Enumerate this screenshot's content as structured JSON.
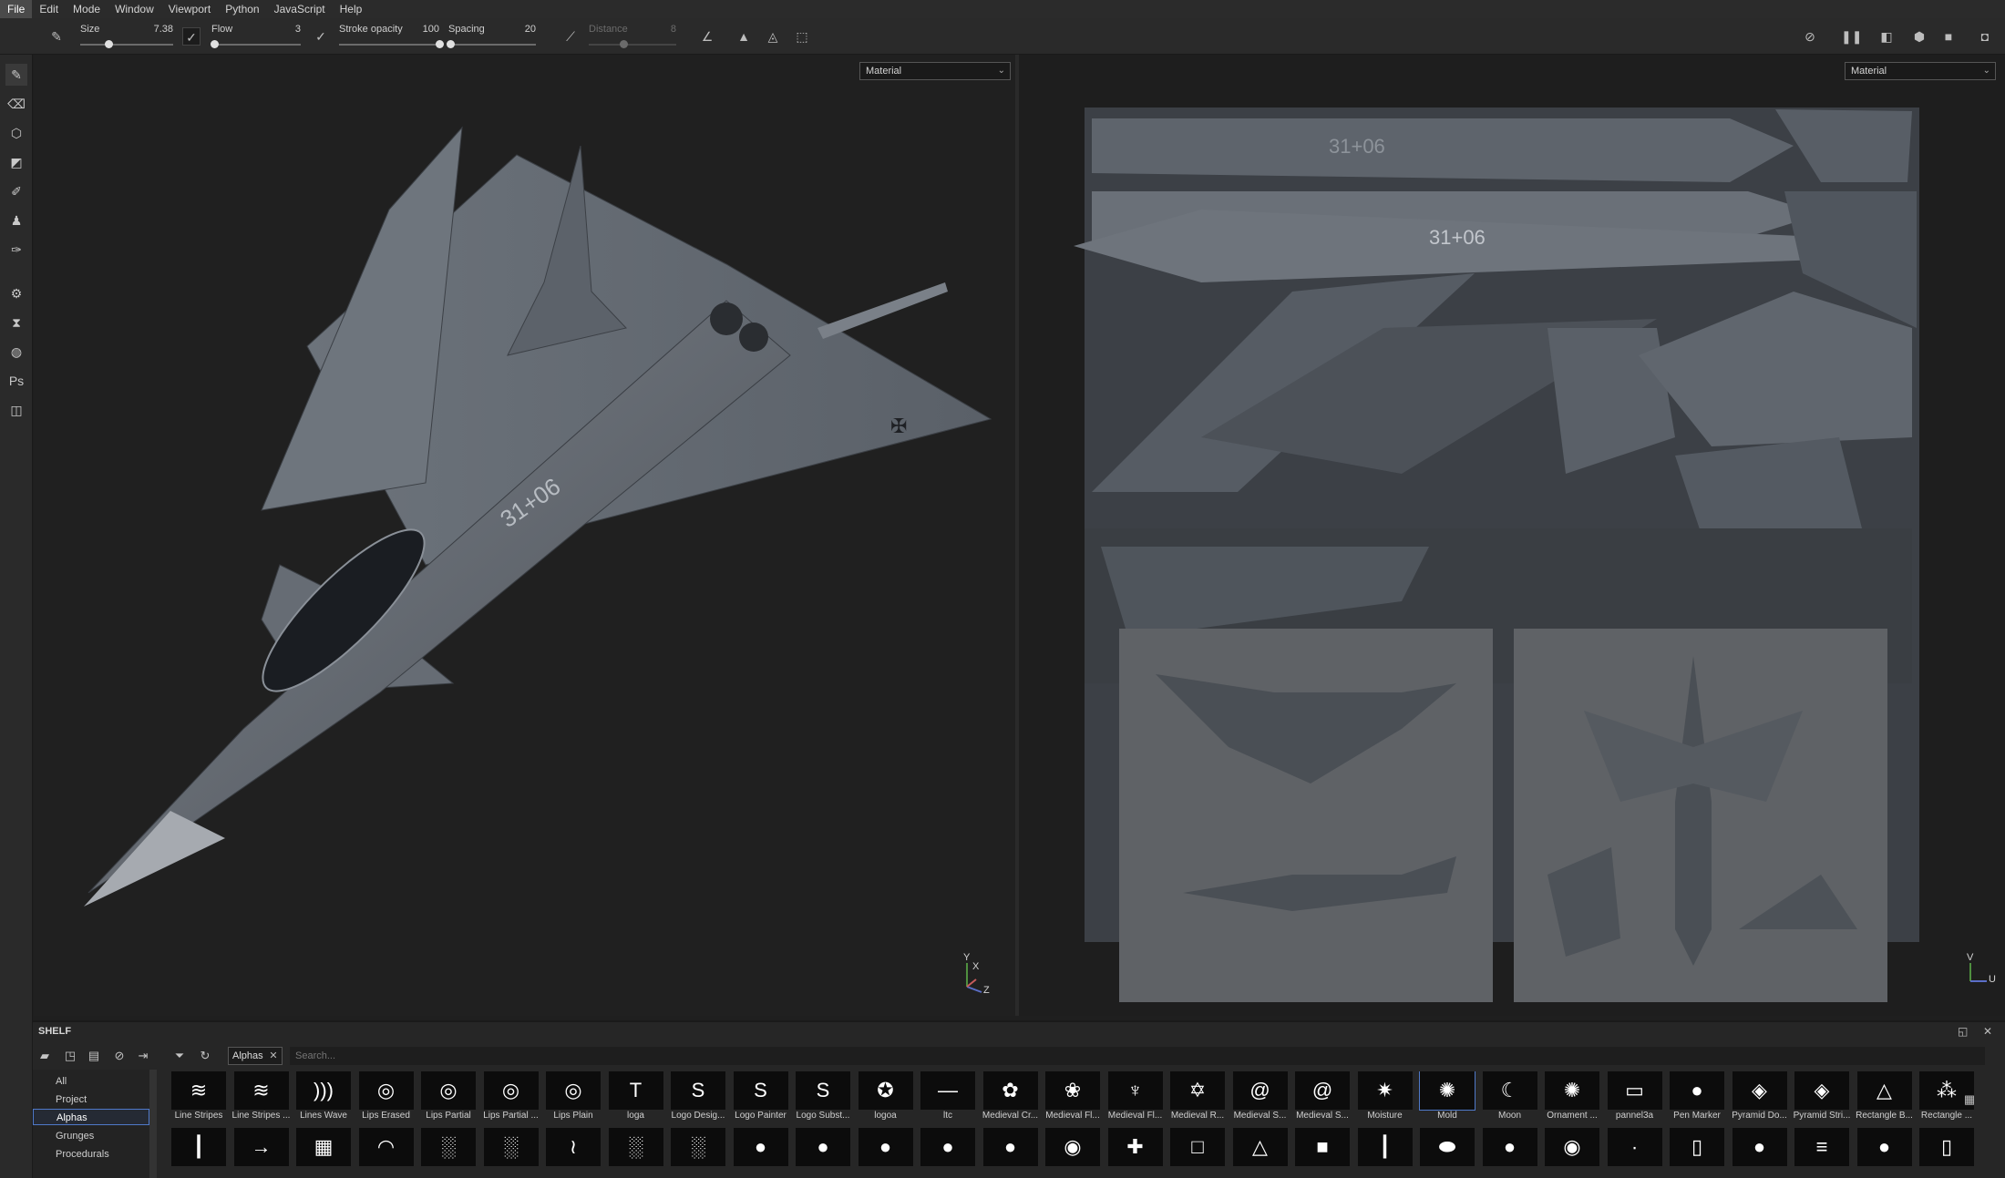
{
  "menu": [
    "File",
    "Edit",
    "Mode",
    "Window",
    "Viewport",
    "Python",
    "JavaScript",
    "Help"
  ],
  "toolbar": {
    "size": {
      "label": "Size",
      "value": "7.38",
      "level": 0.3
    },
    "flow": {
      "label": "Flow",
      "value": "3",
      "level": 0.03
    },
    "stroke_opacity": {
      "label": "Stroke opacity",
      "value": "100",
      "level": 1.0
    },
    "spacing": {
      "label": "Spacing",
      "value": "20",
      "level": 0.02
    },
    "distance": {
      "label": "Distance",
      "value": "8",
      "level": 0.4
    }
  },
  "viewport3d": {
    "mode": "Material",
    "axes": {
      "y": "Y",
      "x": "X",
      "z": "Z"
    }
  },
  "viewport2d": {
    "mode": "Material",
    "axes": {
      "v": "V",
      "u": "U"
    }
  },
  "uv_texts": {
    "serial": "31+06"
  },
  "shelf": {
    "title": "SHELF",
    "filter_tag": "Alphas",
    "search_placeholder": "Search...",
    "categories": [
      "All",
      "Project",
      "Alphas",
      "Grunges",
      "Procedurals"
    ],
    "active_category": "Alphas",
    "row1": [
      "Line Stripes",
      "Line Stripes ...",
      "Lines Wave",
      "Lips Erased",
      "Lips Partial",
      "Lips Partial ...",
      "Lips Plain",
      "loga",
      "Logo Desig...",
      "Logo Painter",
      "Logo Subst...",
      "logoa",
      "ltc",
      "Medieval Cr...",
      "Medieval Fl...",
      "Medieval Fl...",
      "Medieval R...",
      "Medieval S...",
      "Medieval S...",
      "Moisture",
      "Mold",
      "Moon",
      "Ornament ...",
      "pannel3a",
      "Pen Marker",
      "Pyramid Do...",
      "Pyramid Stri...",
      "Rectangle B...",
      "Rectangle ..."
    ],
    "row1_icons": [
      "≋",
      "≋",
      ")))",
      "◎",
      "◎",
      "◎",
      "◎",
      "T",
      "S",
      "S",
      "S",
      "✪",
      "—",
      "✿",
      "❀",
      "♆",
      "✡",
      "@",
      "@",
      "✷",
      "✺",
      "☾",
      "✺",
      "▭",
      "●",
      "◈",
      "◈",
      "△",
      "⁂"
    ],
    "row2_icons": [
      "┃",
      "→",
      "▦",
      "◠",
      "░",
      "░",
      "≀",
      "░",
      "░",
      "●",
      "●",
      "●",
      "●",
      "●",
      "◉",
      "✚",
      "□",
      "△",
      "■",
      "┃",
      "⬬",
      "●",
      "◉",
      "∙",
      "▯",
      "●",
      "≡",
      "●",
      "▯"
    ],
    "selected_index": 20
  }
}
